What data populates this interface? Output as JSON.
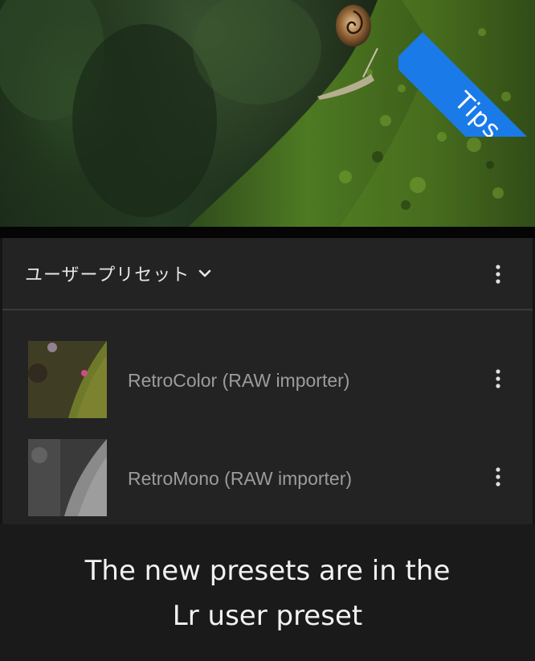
{
  "badge": {
    "label": "Tips",
    "color": "#1a7be8"
  },
  "photo": {
    "description_icon": "snail-on-mossy-trunk-photo"
  },
  "panel": {
    "group_title": "ユーザープリセット",
    "group_chevron": "chevron-down-icon",
    "menu_icon": "more-vertical-icon",
    "presets": [
      {
        "name": "RetroColor (RAW importer)",
        "thumb": "color"
      },
      {
        "name": "RetroMono (RAW importer)",
        "thumb": "mono"
      }
    ]
  },
  "caption": {
    "line1": "The new presets are in the",
    "line2": "Lr user preset"
  }
}
